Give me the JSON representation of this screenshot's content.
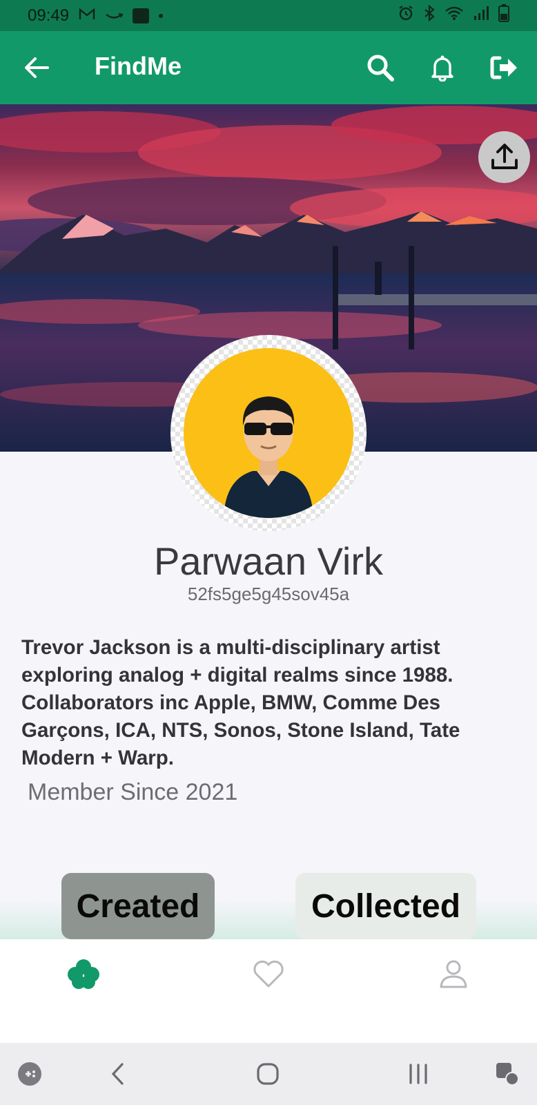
{
  "status_bar": {
    "time": "09:49",
    "left_icons": [
      "gmail-icon",
      "amazon-icon",
      "app-icon",
      "dot-icon"
    ],
    "right_icons": [
      "alarm-icon",
      "bluetooth-icon",
      "wifi-icon",
      "signal-icon",
      "battery-icon"
    ]
  },
  "app_bar": {
    "title": "FindMe",
    "background": "#12996a",
    "icons": [
      "back-arrow-icon",
      "search-icon",
      "bell-icon",
      "logout-icon"
    ]
  },
  "profile": {
    "name": "Parwaan Virk",
    "id": "52fs5ge5g45sov45a",
    "bio": "Trevor Jackson is a multi-disciplinary artist exploring analog + digital realms since 1988. Collaborators inc Apple, BMW, Comme Des Garçons, ICA, NTS, Sonos, Stone Island, Tate Modern + Warp.",
    "member_since": "Member Since 2021"
  },
  "tabs": [
    {
      "label": "Created",
      "selected": true
    },
    {
      "label": "Collected",
      "selected": false
    }
  ],
  "bottom_nav": {
    "items": [
      {
        "icon": "clover-icon",
        "active": true,
        "color": "#12996a"
      },
      {
        "icon": "heart-icon",
        "active": false,
        "color": "#b8b8bc"
      },
      {
        "icon": "person-icon",
        "active": false,
        "color": "#b8b8bc"
      }
    ]
  },
  "system_nav": [
    "game-launcher-icon",
    "back-icon",
    "home-icon",
    "recents-icon",
    "assistant-icon"
  ]
}
